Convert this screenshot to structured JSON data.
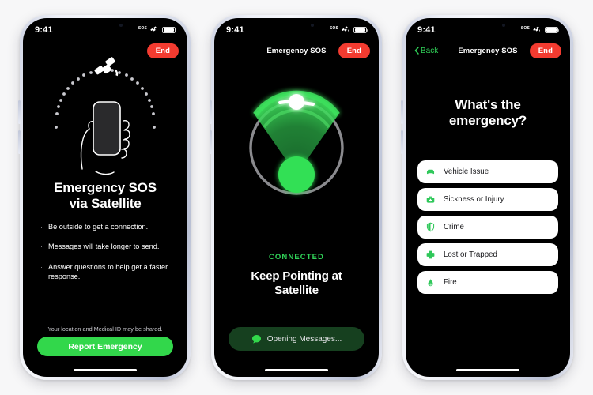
{
  "meta": {
    "background_color": "#f7f7f8",
    "accent_green": "#32d74b",
    "accent_red": "#f33b30",
    "screen_bg": "#000000"
  },
  "status_bar": {
    "time": "9:41",
    "sos_label": "SOS",
    "satellite_icon": "satellite-icon",
    "battery_icon": "battery-icon"
  },
  "phones": {
    "one": {
      "nav": {
        "title": "",
        "end_label": "End"
      },
      "art": {
        "icon": "hand-holding-phone-with-satellite-arc"
      },
      "heading_line1": "Emergency SOS",
      "heading_line2": "via Satellite",
      "bullets": [
        "Be outside to get a connection.",
        "Messages will take longer to send.",
        "Answer questions to help get a faster response."
      ],
      "footnote": "Your location and Medical ID may be shared.",
      "primary_button": "Report Emergency"
    },
    "two": {
      "nav": {
        "title": "Emergency SOS",
        "end_label": "End"
      },
      "radar": {
        "icon": "satellite-pointing-radar",
        "ring_color": "#a8a8ad",
        "beam_color": "#30d158",
        "node_color": "#32e055"
      },
      "status_label": "CONNECTED",
      "heading_line1": "Keep Pointing at",
      "heading_line2": "Satellite",
      "message_pill": {
        "icon": "message-bubble-icon",
        "label": "Opening Messages..."
      }
    },
    "three": {
      "nav": {
        "back_label": "Back",
        "title": "Emergency SOS",
        "end_label": "End"
      },
      "heading_line1": "What's the",
      "heading_line2": "emergency?",
      "options": [
        {
          "label": "Vehicle Issue",
          "icon": "car-icon"
        },
        {
          "label": "Sickness or Injury",
          "icon": "medical-bag-icon"
        },
        {
          "label": "Crime",
          "icon": "shield-icon"
        },
        {
          "label": "Lost or Trapped",
          "icon": "cross-icon"
        },
        {
          "label": "Fire",
          "icon": "flame-icon"
        }
      ]
    }
  }
}
